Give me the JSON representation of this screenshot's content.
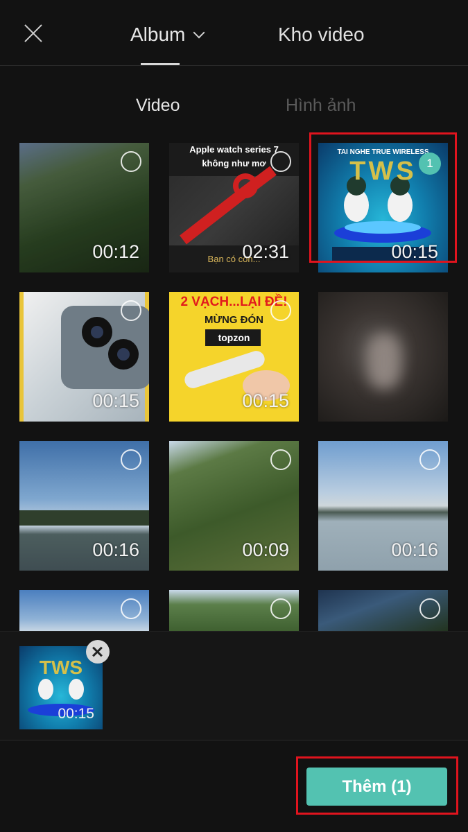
{
  "header": {
    "close_icon": "close-icon",
    "tab_album": "Album",
    "tab_kho_video": "Kho video"
  },
  "subtabs": {
    "video": "Video",
    "photo": "Hình ảnh"
  },
  "grid": [
    {
      "duration": "00:12",
      "selected": false
    },
    {
      "duration": "02:31",
      "selected": false,
      "top_text_1": "Apple watch series 7",
      "top_text_2": "không như mơ",
      "bottom_text": "Bạn có còn..."
    },
    {
      "duration": "00:15",
      "selected": true,
      "selection_number": "1",
      "top_text_1": "TAI NGHE TRUE WIRELESS",
      "big_text": "TWS"
    },
    {
      "duration": "00:15",
      "selected": false
    },
    {
      "duration": "00:15",
      "selected": false,
      "top_text_1": "2 VẠCH...LẠI ĐỀ!",
      "top_text_2": "MỪNG ĐÓN",
      "badge_text": "topzon"
    },
    {
      "duration": "",
      "selected": false
    },
    {
      "duration": "00:16",
      "selected": false
    },
    {
      "duration": "00:09",
      "selected": false
    },
    {
      "duration": "00:16",
      "selected": false
    },
    {
      "duration": "",
      "selected": false
    },
    {
      "duration": "",
      "selected": false
    },
    {
      "duration": "",
      "selected": false
    }
  ],
  "selected_tray": {
    "items": [
      {
        "duration": "00:15"
      }
    ],
    "remove_icon": "close-icon"
  },
  "add_button": {
    "label": "Thêm (1)"
  },
  "colors": {
    "accent": "#53c2b1",
    "highlight": "#e0141e",
    "background": "#121212"
  }
}
